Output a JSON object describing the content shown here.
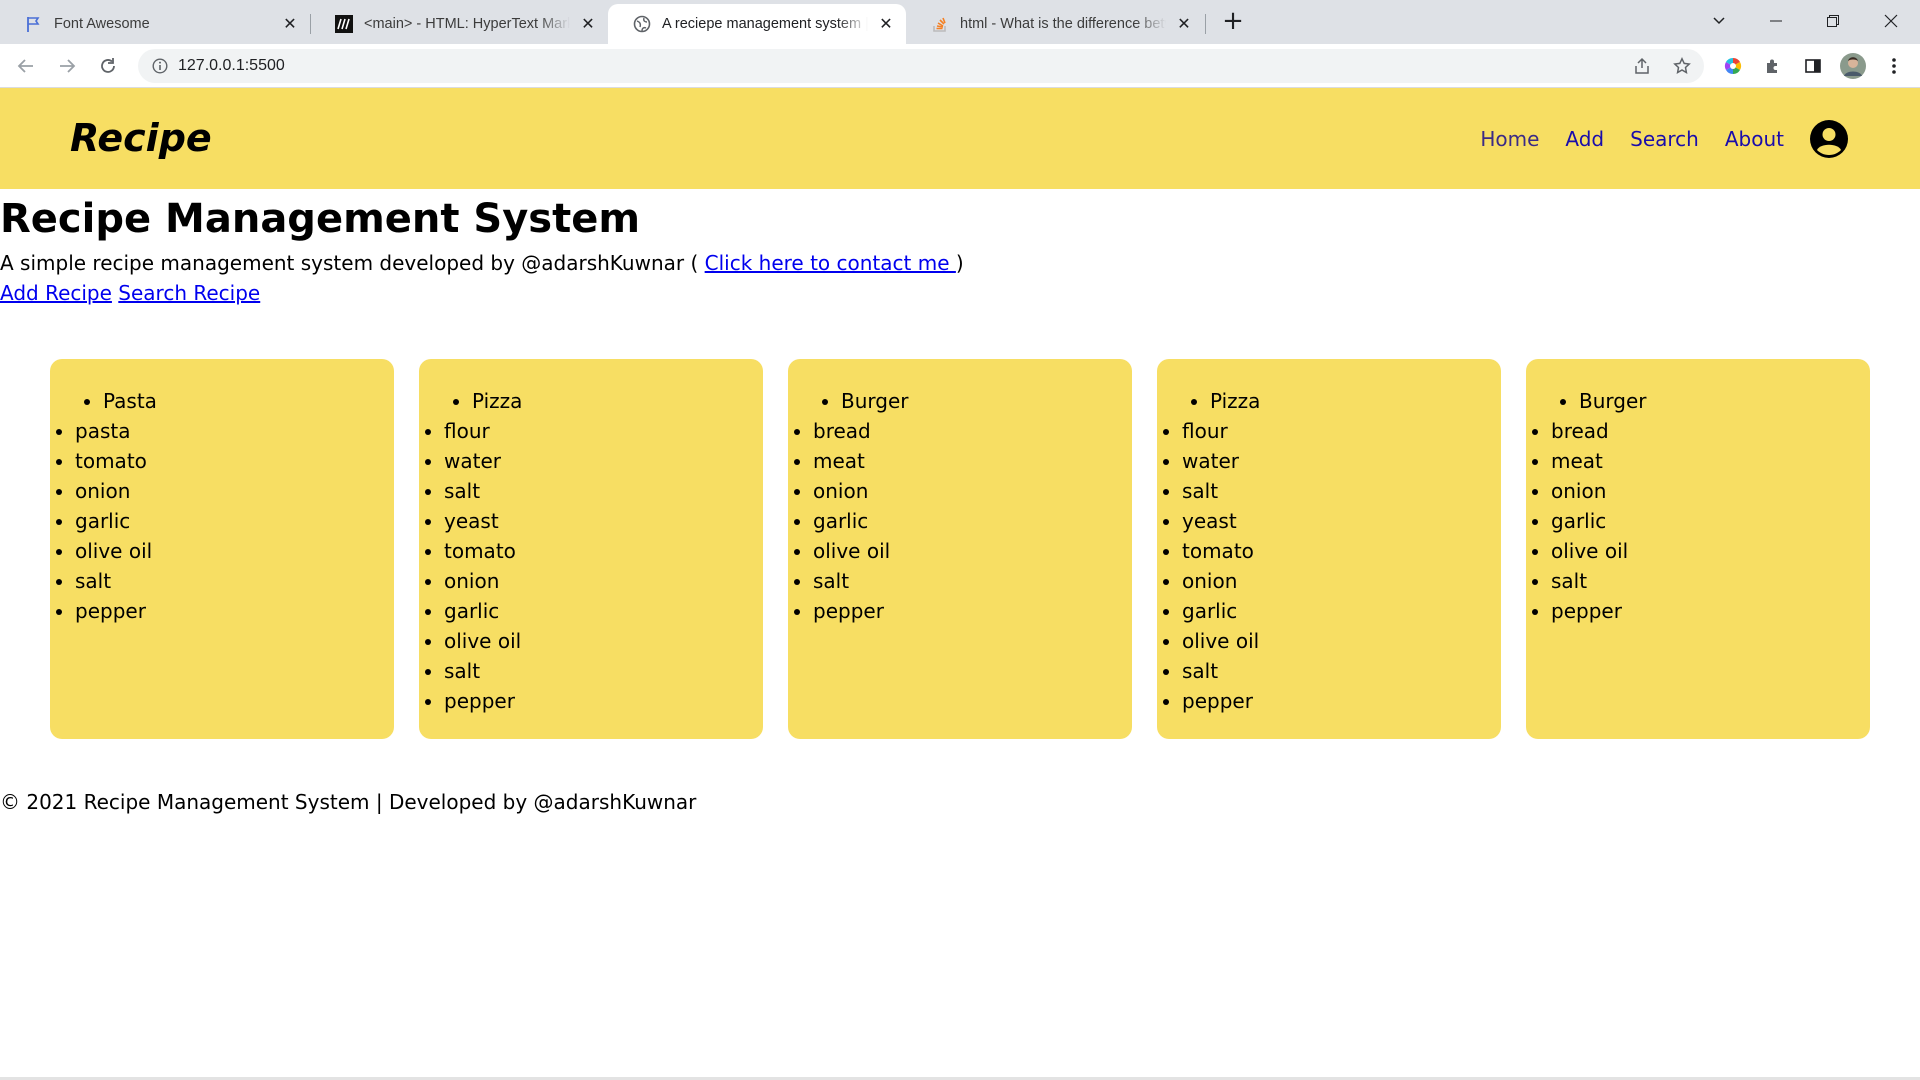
{
  "browser": {
    "tabs": [
      {
        "title": "Font Awesome",
        "icon": "flag-icon",
        "active": false
      },
      {
        "title": "<main> - HTML: HyperText Markup Language | MDN",
        "icon": "mdn-icon",
        "active": false
      },
      {
        "title": "A reciepe management system | Recipe",
        "icon": "globe-icon",
        "active": true
      },
      {
        "title": "html - What is the difference between",
        "icon": "stackoverflow-icon",
        "active": false
      }
    ],
    "url": "127.0.0.1:5500"
  },
  "colors": {
    "accent": "#f7de63",
    "link": "#0000ee",
    "nav_link": "#1a0dab"
  },
  "navbar": {
    "brand": "Recipe",
    "links": [
      "Home",
      "Add",
      "Search",
      "About"
    ],
    "user_icon": "user-circle-icon"
  },
  "main": {
    "title": "Recipe Management System",
    "intro_prefix": "A simple recipe management system developed by @adarshKuwnar ( ",
    "contact_link": "Click here to contact me ",
    "intro_suffix": ")",
    "add_link": "Add Recipe",
    "search_link": "Search Recipe"
  },
  "recipes": [
    {
      "name": "Pasta",
      "ingredients": [
        "pasta",
        "tomato",
        "onion",
        "garlic",
        "olive oil",
        "salt",
        "pepper"
      ]
    },
    {
      "name": "Pizza",
      "ingredients": [
        "flour",
        "water",
        "salt",
        "yeast",
        "tomato",
        "onion",
        "garlic",
        "olive oil",
        "salt",
        "pepper"
      ]
    },
    {
      "name": "Burger",
      "ingredients": [
        "bread",
        "meat",
        "onion",
        "garlic",
        "olive oil",
        "salt",
        "pepper"
      ]
    },
    {
      "name": "Pizza",
      "ingredients": [
        "flour",
        "water",
        "salt",
        "yeast",
        "tomato",
        "onion",
        "garlic",
        "olive oil",
        "salt",
        "pepper"
      ]
    },
    {
      "name": "Burger",
      "ingredients": [
        "bread",
        "meat",
        "onion",
        "garlic",
        "olive oil",
        "salt",
        "pepper"
      ]
    }
  ],
  "footer": {
    "text": "© 2021 Recipe Management System | Developed by @adarshKuwnar"
  }
}
